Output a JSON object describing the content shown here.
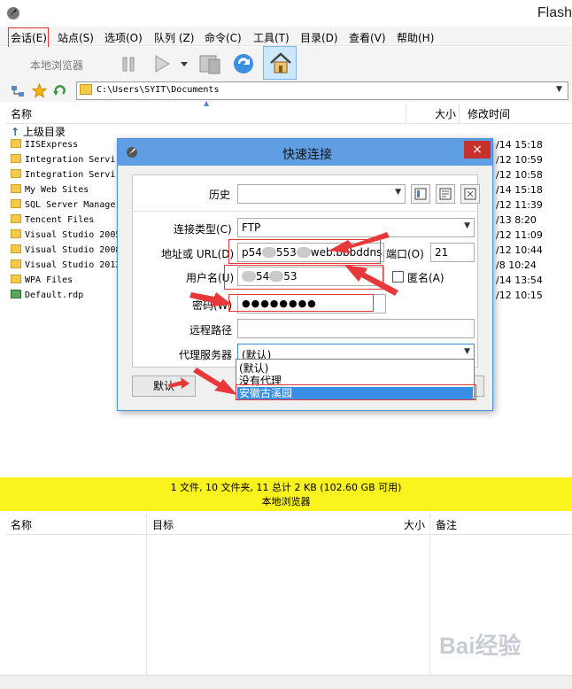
{
  "app": {
    "title": "Flash"
  },
  "menu": [
    "会话(E)",
    "站点(S)",
    "选项(O)",
    "队列 (Z)",
    "命令(C)",
    "工具(T)",
    "目录(D)",
    "查看(V)",
    "帮助(H)"
  ],
  "toolbar": {
    "local_browser_label": "本地浏览器"
  },
  "address": {
    "path": "C:\\Users\\SYIT\\Documents"
  },
  "file_list": {
    "headers": {
      "name": "名称",
      "size": "大小",
      "modified": "修改时间"
    },
    "parent_dir": "上级目录",
    "rows": [
      {
        "name": "IISExpress",
        "date": "/14 15:18"
      },
      {
        "name": "Integration Servi",
        "date": "/12 10:59"
      },
      {
        "name": "Integration Servi",
        "date": "/12 10:58"
      },
      {
        "name": "My Web Sites",
        "date": "/14 15:18"
      },
      {
        "name": "SQL Server Manager",
        "date": "/12 11:39"
      },
      {
        "name": "Tencent Files",
        "date": "/13 8:20"
      },
      {
        "name": "Visual Studio 2005",
        "date": "/12 11:09"
      },
      {
        "name": "Visual Studio 2008",
        "date": "/12 10:44"
      },
      {
        "name": "Visual Studio 2012",
        "date": "/8 10:24"
      },
      {
        "name": "WPA Files",
        "date": "/14 13:54"
      },
      {
        "name": "Default.rdp",
        "date": "/12 10:15"
      }
    ]
  },
  "status": {
    "summary": "1 文件, 10 文件夹, 11 总计 2 KB (102.60 GB 可用)",
    "pane": "本地浏览器"
  },
  "queue": {
    "headers": {
      "name": "名称",
      "target": "目标",
      "size": "大小",
      "note": "备注"
    }
  },
  "dialog": {
    "title": "快速连接",
    "close": "×",
    "history_label": "历史",
    "conn_type_label": "连接类型(C)",
    "conn_type_value": "FTP",
    "url_label": "地址或 URL(D)",
    "url_value_a": "p54",
    "url_value_b": "553",
    "url_value_c": "web.bbbddns.cc",
    "port_label": "端口(O)",
    "port_value": "21",
    "user_label": "用户名(U)",
    "user_value_a": "54",
    "user_value_b": "53",
    "anon_label": "匿名(A)",
    "password_label": "密码(W)",
    "password_value": "●●●●●●●●",
    "remote_path_label": "远程路径",
    "proxy_label": "代理服务器",
    "proxy_value": "(默认)",
    "proxy_options": [
      "(默认)",
      "没有代理",
      "安徽古溪园"
    ],
    "default_button": "默认"
  },
  "watermark": "Bai经验",
  "colors": {
    "status_yellow": "#faf31e",
    "annotation_red": "#e8393a",
    "titlebar_blue": "#5f9ee3"
  }
}
